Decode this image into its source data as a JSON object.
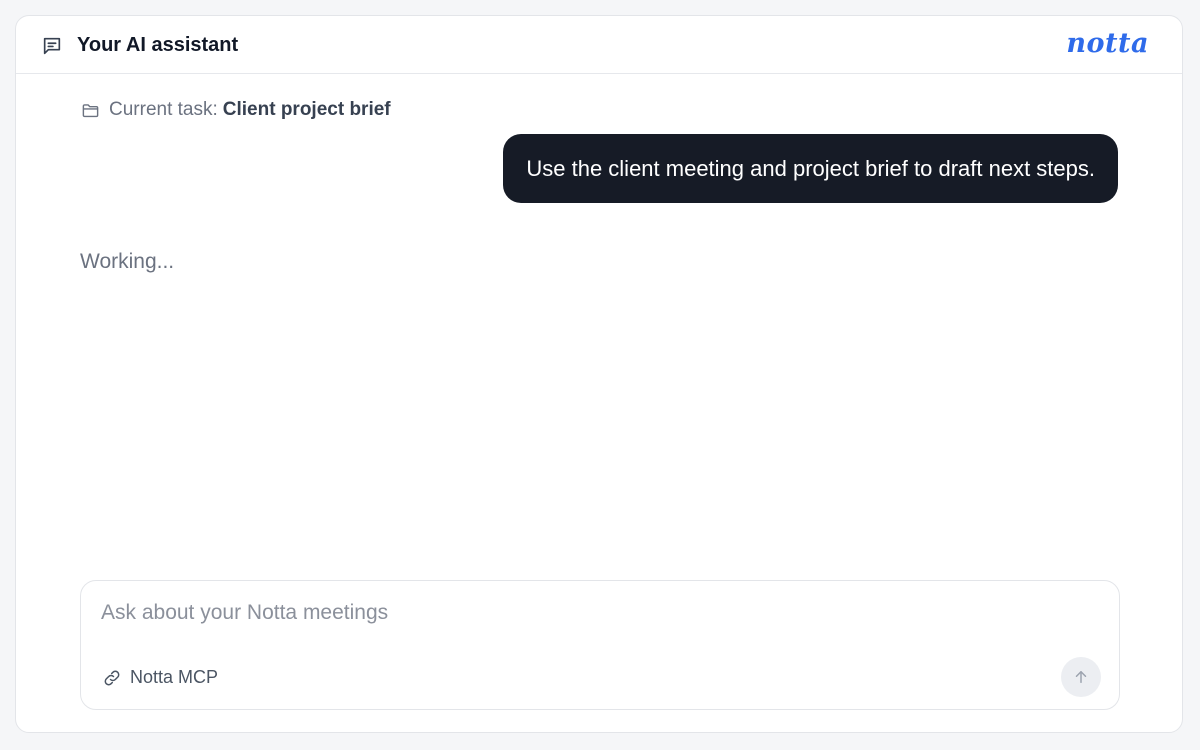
{
  "header": {
    "title": "Your AI assistant",
    "icon": "message-square-icon",
    "brand": "notta"
  },
  "task": {
    "label": "Current task:",
    "name": "Client project brief",
    "icon": "folder-icon"
  },
  "conversation": {
    "user_message": "Use the client meeting and project brief to draft next steps.",
    "status": "Working..."
  },
  "composer": {
    "placeholder": "Ask about your Notta meetings",
    "value": "",
    "connector_label": "Notta MCP",
    "connector_icon": "link-icon",
    "send_icon": "arrow-up-icon"
  },
  "colors": {
    "brand": "#2f6bea",
    "bubble": "#161b26",
    "page_background": "#f5f6f8"
  }
}
